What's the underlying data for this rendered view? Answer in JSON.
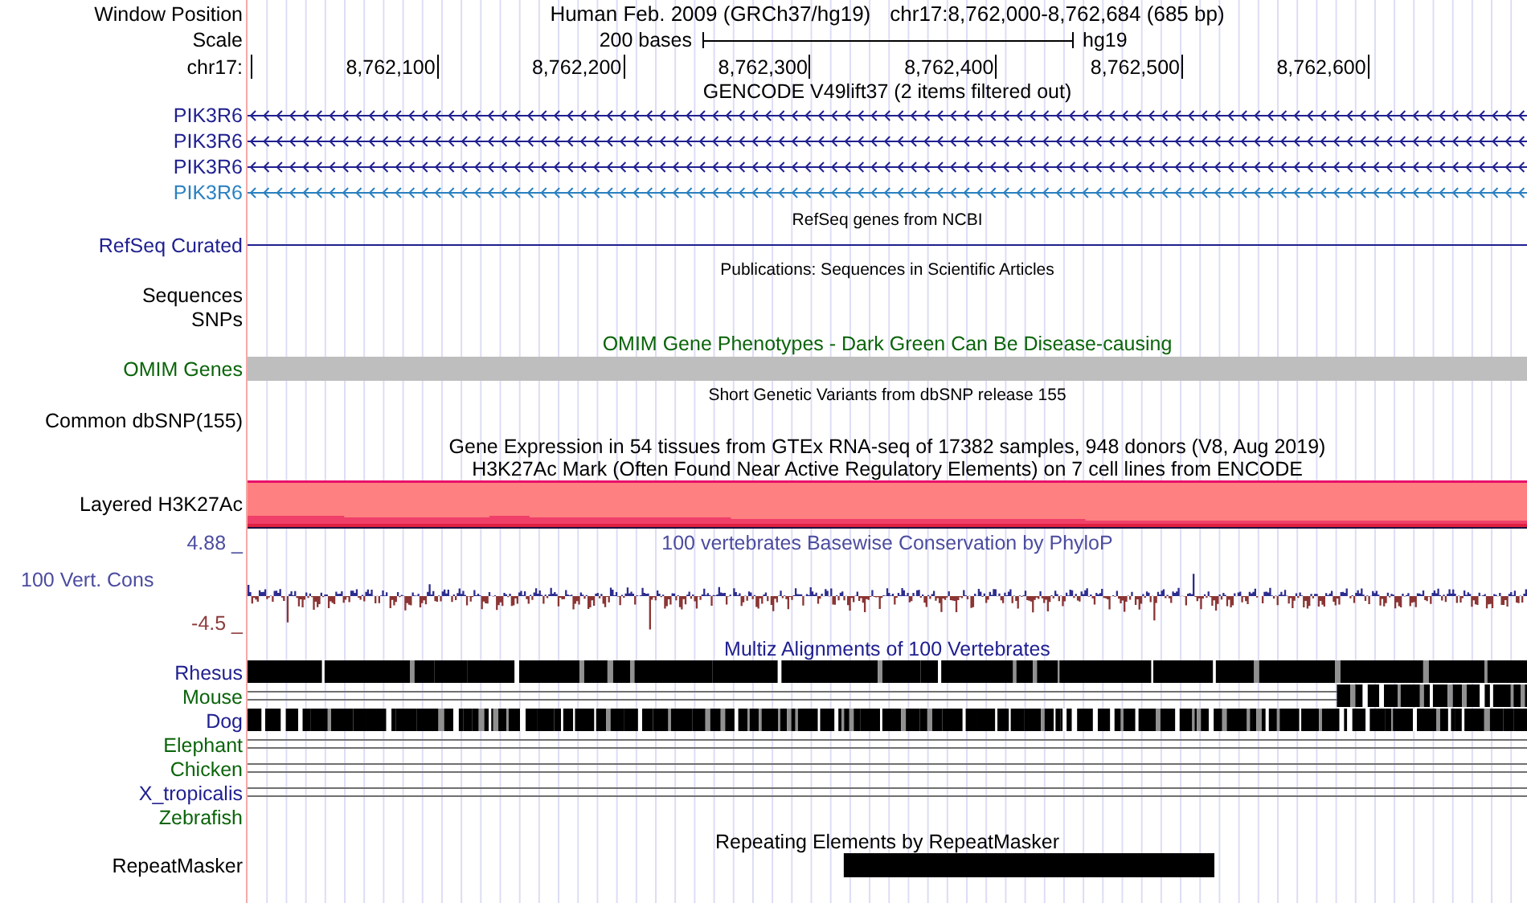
{
  "position": {
    "label": "Window Position",
    "assembly": "Human Feb. 2009 (GRCh37/hg19)",
    "range": "chr17:8,762,000-8,762,684 (685 bp)"
  },
  "scale": {
    "label": "Scale",
    "length": "200 bases",
    "build": "hg19"
  },
  "ruler": {
    "label": "chr17:",
    "ticks": [
      "8,762,100",
      "8,762,200",
      "8,762,300",
      "8,762,400",
      "8,762,500",
      "8,762,600"
    ]
  },
  "tracks": [
    {
      "kind": "gencode",
      "title": "GENCODE V49lift37 (2 items filtered out)",
      "genes": [
        {
          "name": "PIK3R6",
          "color": "#202090"
        },
        {
          "name": "PIK3R6",
          "color": "#202090"
        },
        {
          "name": "PIK3R6",
          "color": "#202090"
        },
        {
          "name": "PIK3R6",
          "color": "#2a80c0"
        }
      ]
    },
    {
      "kind": "refseq",
      "title": "RefSeq genes from NCBI",
      "label": "RefSeq Curated"
    },
    {
      "kind": "publications",
      "title": "Publications: Sequences in Scientific Articles",
      "labels": [
        "Sequences",
        "SNPs"
      ]
    },
    {
      "kind": "omim",
      "title": "OMIM Gene Phenotypes - Dark Green Can Be Disease-causing",
      "label": "OMIM Genes"
    },
    {
      "kind": "dbsnp",
      "title": "Short Genetic Variants from dbSNP release 155",
      "label": "Common dbSNP(155)"
    },
    {
      "kind": "gtex",
      "title": "Gene Expression in 54 tissues from GTEx RNA-seq of 17382 samples, 948 donors (V8, Aug 2019)"
    },
    {
      "kind": "h3k27ac",
      "title": "H3K27Ac Mark (Often Found Near Active Regulatory Elements) on 7 cell lines from ENCODE",
      "label": "Layered H3K27Ac"
    },
    {
      "kind": "conservation",
      "title": "100 vertebrates Basewise Conservation by PhyloP",
      "label": "100 Vert. Cons",
      "max": "4.88 _",
      "min": "-4.5 _"
    },
    {
      "kind": "multiz",
      "title": "Multiz Alignments of 100 Vertebrates",
      "species": [
        {
          "name": "Rhesus",
          "color": "#202090",
          "kind": "solid"
        },
        {
          "name": "Mouse",
          "color": "#0a640a",
          "kind": "partial"
        },
        {
          "name": "Dog",
          "color": "#202090",
          "kind": "striped"
        },
        {
          "name": "Elephant",
          "color": "#0a640a",
          "kind": "gap"
        },
        {
          "name": "Chicken",
          "color": "#0a640a",
          "kind": "gap"
        },
        {
          "name": "X_tropicalis",
          "color": "#202090",
          "kind": "gap"
        },
        {
          "name": "Zebrafish",
          "color": "#0a640a",
          "kind": "empty"
        }
      ]
    },
    {
      "kind": "repeatmasker",
      "title": "Repeating Elements by RepeatMasker",
      "label": "RepeatMasker"
    }
  ]
}
